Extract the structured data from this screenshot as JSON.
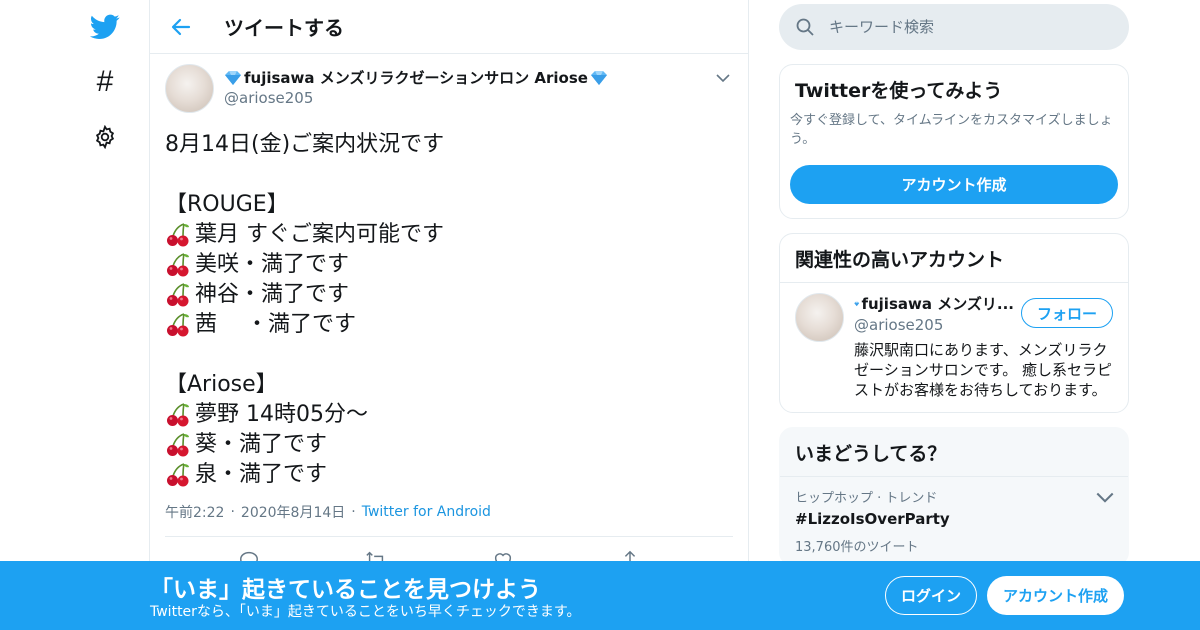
{
  "colors": {
    "accent": "#1da1f2",
    "text": "#14171a",
    "secondary": "#657786",
    "border": "#e6ecf0",
    "link": "#1b95e0"
  },
  "nav": {
    "icons": [
      "twitter-bird-icon",
      "hashtag-icon",
      "gear-icon"
    ],
    "hashtag_glyph": "#"
  },
  "header": {
    "title": "ツイートする"
  },
  "tweet": {
    "author": {
      "name": "fujisawa メンズリラクゼーションサロン Ariose",
      "handle": "@ariose205"
    },
    "lines": [
      {
        "cherry": false,
        "text": "8月14日(金)ご案内状況です"
      },
      {
        "cherry": false,
        "text": ""
      },
      {
        "cherry": false,
        "text": "【ROUGE】"
      },
      {
        "cherry": true,
        "text": "葉月 すぐご案内可能です"
      },
      {
        "cherry": true,
        "text": "美咲・満了です"
      },
      {
        "cherry": true,
        "text": "神谷・満了です"
      },
      {
        "cherry": true,
        "text": "茜　 ・満了です"
      },
      {
        "cherry": false,
        "text": ""
      },
      {
        "cherry": false,
        "text": "【Ariose】"
      },
      {
        "cherry": true,
        "text": "夢野 14時05分～"
      },
      {
        "cherry": true,
        "text": "葵・満了です"
      },
      {
        "cherry": true,
        "text": "泉・満了です"
      }
    ],
    "time": "午前2:22",
    "date": "2020年8月14日",
    "source": "Twitter for Android",
    "separator": "·"
  },
  "search": {
    "placeholder": "キーワード検索"
  },
  "signup_card": {
    "title": "Twitterを使ってみよう",
    "description": "今すぐ登録して、タイムラインをカスタマイズしましょう。",
    "button": "アカウント作成"
  },
  "related": {
    "title": "関連性の高いアカウント",
    "account": {
      "name": "fujisawa メンズリ...",
      "handle": "@ariose205",
      "bio": "藤沢駅南口にあります、メンズリラクゼーションサロンです。 癒し系セラピストがお客様をお待ちしております。",
      "follow": "フォロー"
    }
  },
  "trends": {
    "title": "いまどうしてる？",
    "items": [
      {
        "category": "ヒップホップ · トレンド",
        "name": "#LizzoIsOverParty",
        "count": "13,760件のツイート"
      }
    ]
  },
  "bottom_bar": {
    "title": "「いま」起きていることを見つけよう",
    "subtitle": "Twitterなら、「いま」起きていることをいち早くチェックできます。",
    "login": "ログイン",
    "signup": "アカウント作成"
  }
}
